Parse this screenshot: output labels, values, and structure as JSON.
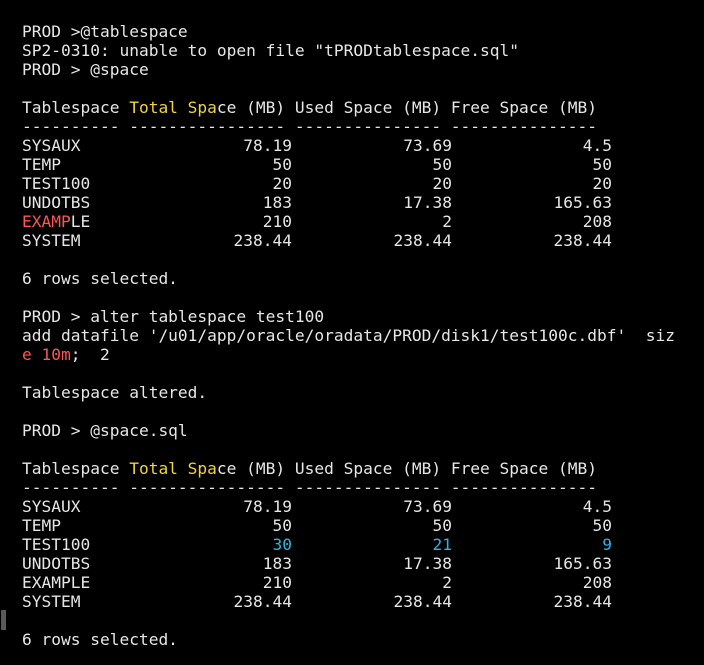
{
  "session": [
    {
      "type": "text",
      "text": "PROD >@tablespace"
    },
    {
      "type": "text",
      "text": "SP2-0310: unable to open file \"tPRODtablespace.sql\""
    },
    {
      "type": "text",
      "text": "PROD > @space"
    },
    {
      "type": "blank"
    },
    {
      "type": "header",
      "parts": [
        [
          "Tablespace ",
          ""
        ],
        [
          "Total Spa",
          "y"
        ],
        [
          "ce (MB) Used Space (MB) Free Space (MB)",
          ""
        ]
      ]
    },
    {
      "type": "text",
      "text": "---------- ---------------- --------------- ---------------"
    },
    {
      "type": "row",
      "cells": [
        "SYSAUX",
        "78.19",
        "73.69",
        "4.5"
      ]
    },
    {
      "type": "row",
      "cells": [
        "TEMP",
        "50",
        "50",
        "50"
      ]
    },
    {
      "type": "row",
      "cells": [
        "TEST100",
        "20",
        "20",
        "20"
      ]
    },
    {
      "type": "row",
      "cells": [
        "UNDOTBS",
        "183",
        "17.38",
        "165.63"
      ]
    },
    {
      "type": "row",
      "cells": [
        "EXAMPLE",
        "210",
        "2",
        "208"
      ],
      "name_parts": [
        [
          "EXAMP",
          "r"
        ],
        [
          "LE",
          ""
        ]
      ]
    },
    {
      "type": "row",
      "cells": [
        "SYSTEM",
        "238.44",
        "238.44",
        "238.44"
      ]
    },
    {
      "type": "blank"
    },
    {
      "type": "text",
      "text": "6 rows selected."
    },
    {
      "type": "blank"
    },
    {
      "type": "text",
      "text": "PROD > alter tablespace test100"
    },
    {
      "type": "text",
      "text": "add datafile '/u01/app/oracle/oradata/PROD/disk1/test100c.dbf'  siz"
    },
    {
      "type": "parts",
      "parts": [
        [
          "e 10m",
          "r"
        ],
        [
          ";  2",
          ""
        ]
      ]
    },
    {
      "type": "blank"
    },
    {
      "type": "text",
      "text": "Tablespace altered."
    },
    {
      "type": "blank"
    },
    {
      "type": "text",
      "text": "PROD > @space.sql"
    },
    {
      "type": "blank"
    },
    {
      "type": "header",
      "parts": [
        [
          "Tablespace ",
          ""
        ],
        [
          "Total Spa",
          "y"
        ],
        [
          "ce (MB) Used Space (MB) Free Space (MB)",
          ""
        ]
      ]
    },
    {
      "type": "text",
      "text": "---------- ---------------- --------------- ---------------"
    },
    {
      "type": "row",
      "cells": [
        "SYSAUX",
        "78.19",
        "73.69",
        "4.5"
      ]
    },
    {
      "type": "row",
      "cells": [
        "TEMP",
        "50",
        "50",
        "50"
      ]
    },
    {
      "type": "row",
      "cells": [
        "TEST100",
        "30",
        "21",
        "9"
      ],
      "value_class": "b"
    },
    {
      "type": "row",
      "cells": [
        "UNDOTBS",
        "183",
        "17.38",
        "165.63"
      ]
    },
    {
      "type": "row",
      "cells": [
        "EXAMPLE",
        "210",
        "2",
        "208"
      ]
    },
    {
      "type": "row",
      "cells": [
        "SYSTEM",
        "238.44",
        "238.44",
        "238.44"
      ]
    },
    {
      "type": "blank"
    },
    {
      "type": "text",
      "text": "6 rows selected."
    }
  ],
  "colors": {
    "background": "#000000",
    "foreground": "#e6e6e6",
    "yellow": "#f0d53a",
    "red": "#ff5555",
    "blue": "#2fb3e6"
  }
}
